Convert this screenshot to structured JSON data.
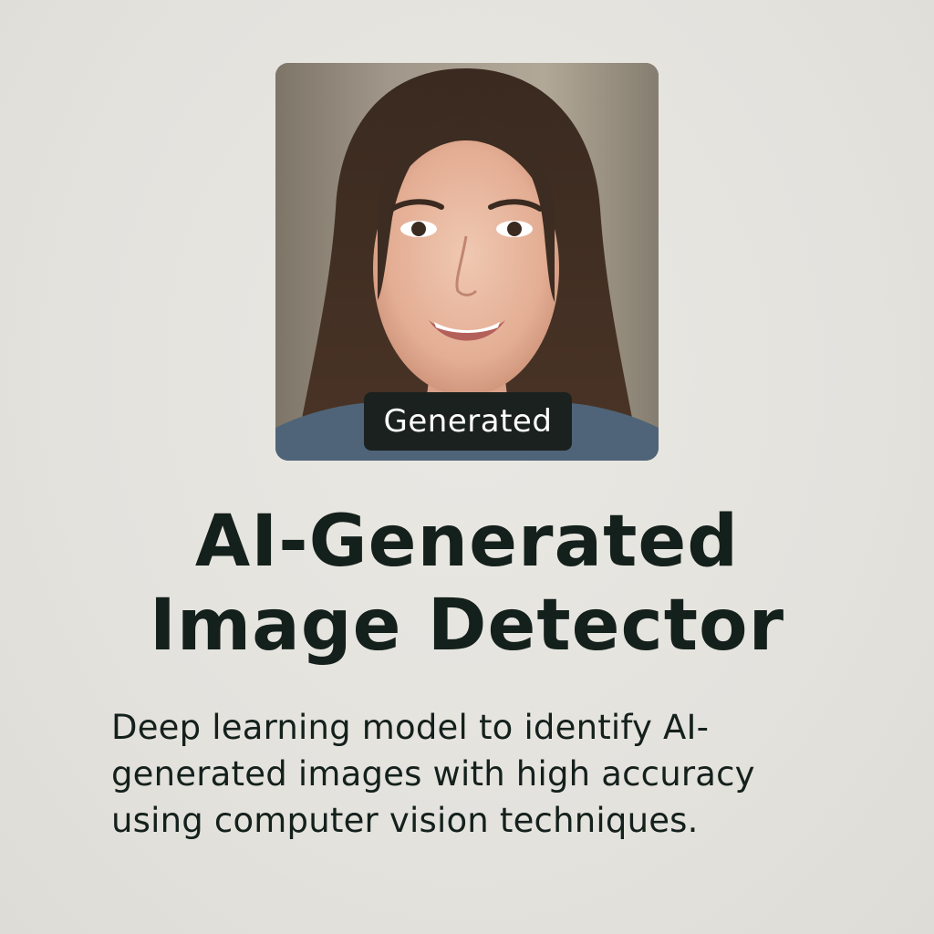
{
  "image_card": {
    "badge_label": "Generated",
    "icon": "portrait-photo"
  },
  "title": {
    "line1": "AI-Generated",
    "line2": "Image Detector"
  },
  "description": {
    "line1": "Deep learning model to identify AI-",
    "line2": "generated images with high accuracy",
    "line3": "using computer vision techniques."
  },
  "colors": {
    "background": "#e6e4df",
    "text": "#14201c",
    "badge_background": "#1b211e",
    "badge_text": "#ffffff"
  }
}
